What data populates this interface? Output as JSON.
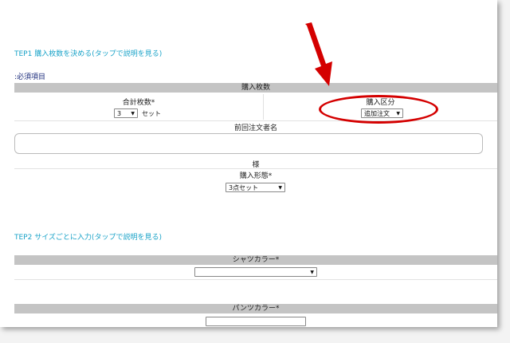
{
  "step1": {
    "title": "TEP1 購入枚数を決める(タップで説明を見る)"
  },
  "required_note": ":必須項目",
  "purchase_count_header": "購入枚数",
  "total_count": {
    "label": "合計枚数*",
    "value": "3",
    "unit": "セット"
  },
  "purchase_type": {
    "label": "購入区分",
    "value": "追加注文"
  },
  "previous_orderer": {
    "label": "前回注文者名",
    "value": "",
    "suffix": "様"
  },
  "purchase_form": {
    "label": "購入形態*",
    "value": "3点セット"
  },
  "step2": {
    "title": "TEP2 サイズごとに入力(タップで説明を見る)"
  },
  "shirt_color": {
    "label": "シャツカラー*",
    "value": ""
  },
  "pants_color": {
    "label": "パンツカラー*"
  },
  "colors": {
    "accent_step": "#1aa3c8",
    "annotation": "#d40000",
    "header_bar": "#c4c4c4"
  },
  "icons": {
    "dropdown": "chevron-down-icon",
    "annotation_arrow": "red-arrow-icon"
  }
}
